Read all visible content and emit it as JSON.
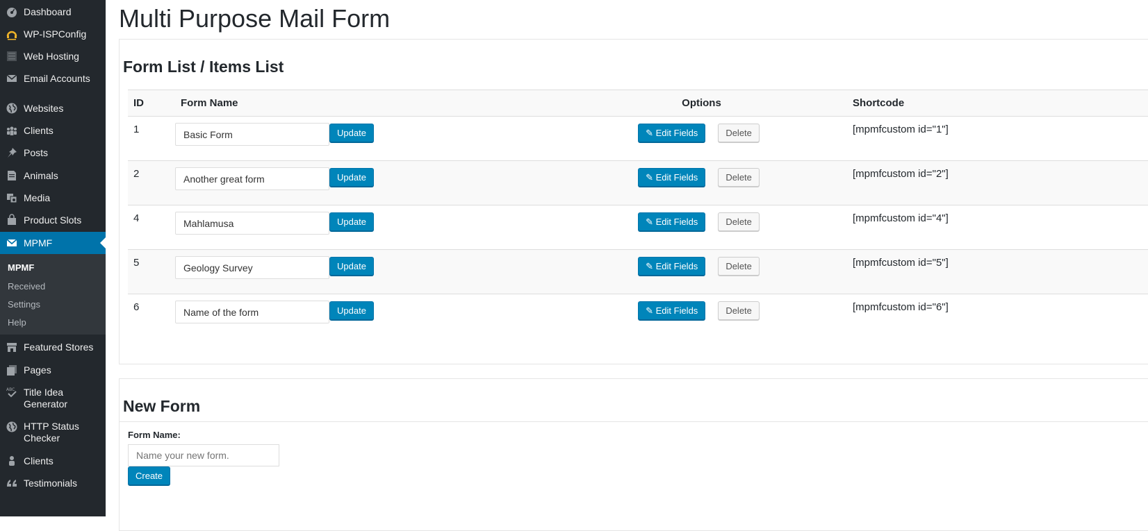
{
  "sidebar": {
    "items": [
      {
        "label": "Dashboard",
        "icon": "dashboard-icon"
      },
      {
        "label": "WP-ISPConfig",
        "icon": "ispconfig-icon"
      },
      {
        "label": "Web Hosting",
        "icon": "server-icon"
      },
      {
        "label": "Email Accounts",
        "icon": "email-icon"
      },
      {
        "label": "Websites",
        "icon": "globe-icon"
      },
      {
        "label": "Clients",
        "icon": "groups-icon"
      },
      {
        "label": "Posts",
        "icon": "pin-icon"
      },
      {
        "label": "Animals",
        "icon": "page-icon"
      },
      {
        "label": "Media",
        "icon": "media-icon"
      },
      {
        "label": "Product Slots",
        "icon": "bag-icon"
      },
      {
        "label": "MPMF",
        "icon": "envelope-icon"
      },
      {
        "label": "Featured Stores",
        "icon": "store-icon"
      },
      {
        "label": "Pages",
        "icon": "pages-icon"
      },
      {
        "label": "Title Idea Generator",
        "icon": "spellcheck-icon"
      },
      {
        "label": "HTTP Status Checker",
        "icon": "globe-icon"
      },
      {
        "label": "Clients",
        "icon": "person-icon"
      },
      {
        "label": "Testimonials",
        "icon": "quote-icon"
      }
    ],
    "submenu": [
      "MPMF",
      "Received",
      "Settings",
      "Help"
    ]
  },
  "page": {
    "title": "Multi Purpose Mail Form"
  },
  "form_list": {
    "heading": "Form List / Items List",
    "columns": {
      "id": "ID",
      "name": "Form Name",
      "options": "Options",
      "shortcode": "Shortcode"
    },
    "update_label": "Update",
    "edit_label": "Edit Fields",
    "delete_label": "Delete",
    "rows": [
      {
        "id": "1",
        "name": "Basic Form",
        "shortcode": "[mpmfcustom id=\"1\"]"
      },
      {
        "id": "2",
        "name": "Another great form",
        "shortcode": "[mpmfcustom id=\"2\"]"
      },
      {
        "id": "4",
        "name": "Mahlamusa",
        "shortcode": "[mpmfcustom id=\"4\"]"
      },
      {
        "id": "5",
        "name": "Geology Survey",
        "shortcode": "[mpmfcustom id=\"5\"]"
      },
      {
        "id": "6",
        "name": "Name of the form",
        "shortcode": "[mpmfcustom id=\"6\"]"
      }
    ]
  },
  "new_form": {
    "heading": "New Form",
    "label": "Form Name:",
    "placeholder": "Name your new form.",
    "create_label": "Create"
  },
  "colors": {
    "sidebar_bg": "#23282d",
    "active_bg": "#0073aa",
    "primary_button": "#0085ba"
  }
}
